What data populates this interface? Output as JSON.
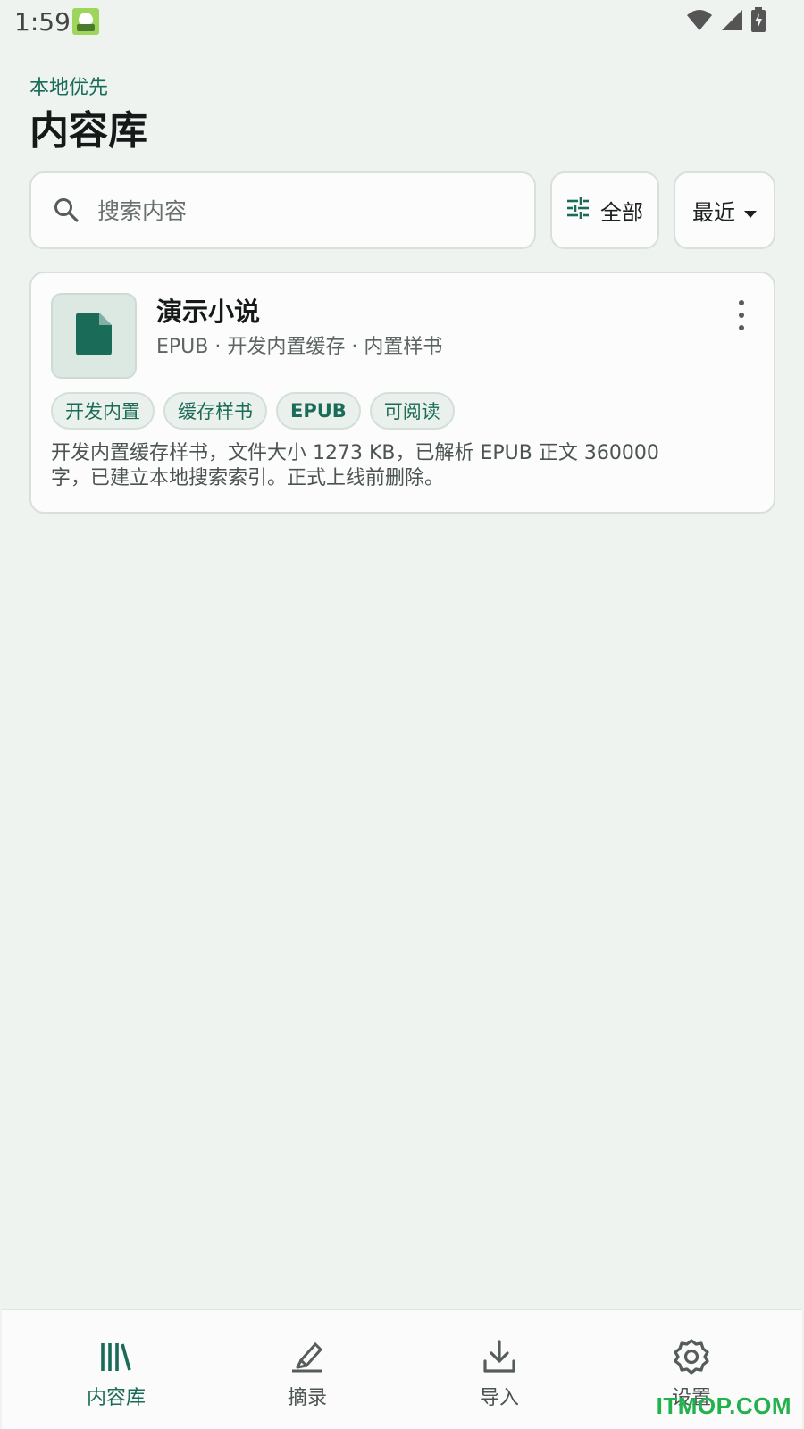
{
  "status_bar": {
    "time": "1:59",
    "icons": [
      "app-notification-icon",
      "wifi-icon",
      "signal-icon",
      "battery-charging-icon"
    ]
  },
  "header": {
    "eyebrow": "本地优先",
    "title": "内容库"
  },
  "search": {
    "placeholder": "搜索内容",
    "value": ""
  },
  "filter": {
    "label": "全部",
    "icon": "tune-icon"
  },
  "sort": {
    "label": "最近",
    "icon": "dropdown-arrow-icon"
  },
  "books": [
    {
      "title": "演示小说",
      "meta": "EPUB · 开发内置缓存 · 内置样书",
      "icon": "document-icon",
      "tags": [
        "开发内置",
        "缓存样书",
        "EPUB",
        "可阅读"
      ],
      "description": "开发内置缓存样书，文件大小 1273 KB，已解析 EPUB 正文 360000 字，已建立本地搜索索引。正式上线前删除。"
    }
  ],
  "bottom_nav": {
    "items": [
      {
        "label": "内容库",
        "icon": "library-icon",
        "active": true
      },
      {
        "label": "摘录",
        "icon": "highlight-pen-icon",
        "active": false
      },
      {
        "label": "导入",
        "icon": "download-icon",
        "active": false
      },
      {
        "label": "设置",
        "icon": "gear-icon",
        "active": false
      }
    ]
  },
  "watermark": "ITMOP.COM",
  "colors": {
    "background": "#eef3f0",
    "accent": "#1a6b57",
    "surface": "#fbfcfb",
    "border": "#d7e0db"
  }
}
